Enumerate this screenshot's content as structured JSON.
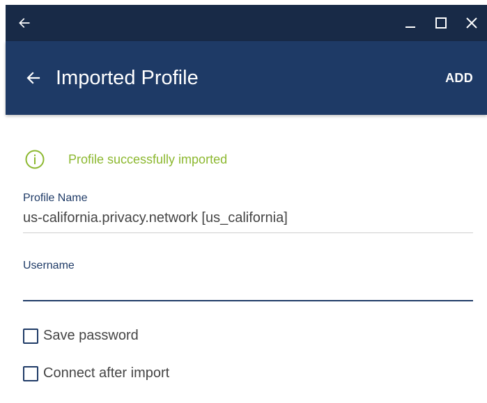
{
  "colors": {
    "titlebar_bg": "#182a47",
    "appbar_bg": "#1e3a66",
    "success_green": "#8cb82f",
    "label_blue": "#1e3a66",
    "text_gray": "#444444"
  },
  "titlebar": {
    "back_icon": "arrow-left-icon",
    "minimize_icon": "minimize-icon",
    "maximize_icon": "maximize-icon",
    "close_icon": "close-icon"
  },
  "appbar": {
    "back_icon": "arrow-left-icon",
    "title": "Imported Profile",
    "action_label": "ADD"
  },
  "notice": {
    "icon": "info-icon",
    "text": "Profile successfully imported"
  },
  "profile_name": {
    "label": "Profile Name",
    "value": "us-california.privacy.network [us_california]"
  },
  "username": {
    "label": "Username",
    "value": ""
  },
  "options": {
    "save_password": {
      "label": "Save password",
      "checked": false
    },
    "connect_after_import": {
      "label": "Connect after import",
      "checked": false
    }
  }
}
